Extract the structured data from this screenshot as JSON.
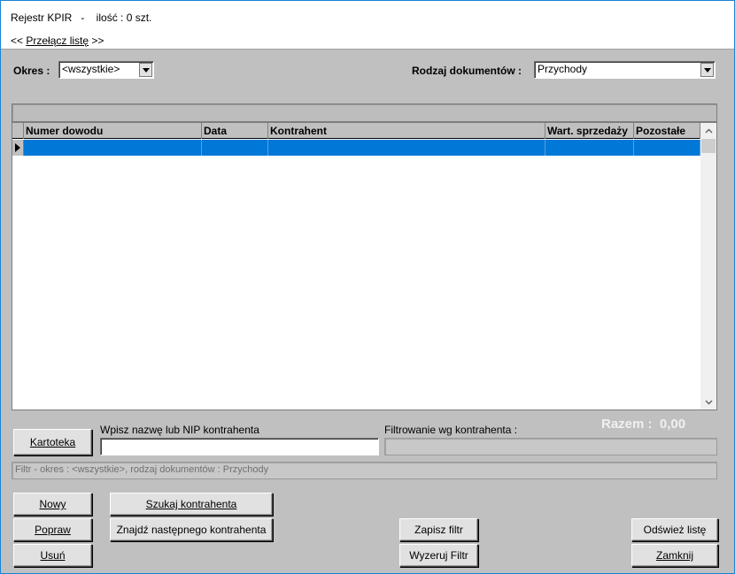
{
  "header": {
    "title": "Rejestr KPIR   -    ilość : 0 szt.",
    "switch_prefix": "<< ",
    "switch_label": "Przełącz listę",
    "switch_suffix": " >>"
  },
  "filters": {
    "okres_label": "Okres :",
    "okres_value": "<wszystkie>",
    "rodzaj_label": "Rodzaj dokumentów :",
    "rodzaj_value": "Przychody"
  },
  "grid": {
    "columns": [
      "Numer dowodu",
      "Data",
      "Kontrahent",
      "Wart. sprzedaży",
      "Pozostałe"
    ],
    "rows": [
      [
        "",
        "",
        "",
        "",
        ""
      ]
    ]
  },
  "totals": {
    "label": "Razem :",
    "value": "0,00"
  },
  "search": {
    "kartoteka_label": "Kartoteka",
    "input_label": "Wpisz nazwę lub NIP kontrahenta",
    "input_value": "",
    "filter_label": "Filtrowanie wg kontrahenta :",
    "filter_value": ""
  },
  "status": {
    "filter_text": "Filtr  -  okres : <wszystkie>,   rodzaj dokumentów : Przychody"
  },
  "buttons": {
    "nowy": "Nowy",
    "popraw": "Popraw",
    "usun": "Usuń",
    "szukaj": "Szukaj kontrahenta",
    "znajdz": "Znajdź następnego kontrahenta",
    "zapisz_filtr": "Zapisz filtr",
    "wyzeruj_filtr": "Wyzeruj Filtr",
    "odswiez": "Odśwież listę",
    "zamknij": "Zamknij"
  }
}
